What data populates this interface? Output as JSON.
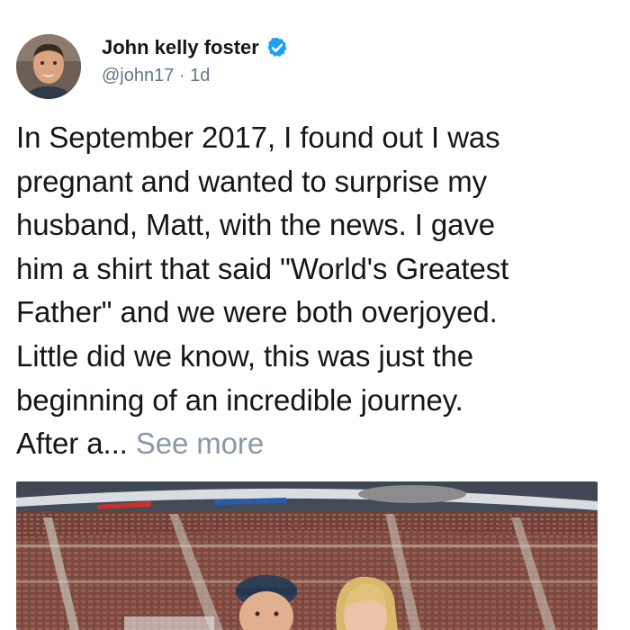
{
  "tweet": {
    "author_name": "John kelly foster",
    "handle": "@john17",
    "separator": " · ",
    "time": "1d",
    "text_lines": [
      "In September 2017, I found out I was",
      "pregnant and wanted to surprise my",
      "husband, Matt, with the news. I gave",
      "him a shirt that said \"World's Greatest",
      "Father\" and we were both overjoyed.",
      "Little did we know, this was just the",
      "beginning of an incredible journey.",
      "After a..."
    ],
    "see_more_label": "See more"
  },
  "icons": {
    "verified": "verified-badge-icon",
    "avatar": "profile-photo"
  },
  "colors": {
    "text": "#14171a",
    "secondary": "#657786",
    "see_more": "#8b98a5",
    "verified_blue": "#1da1f2"
  }
}
